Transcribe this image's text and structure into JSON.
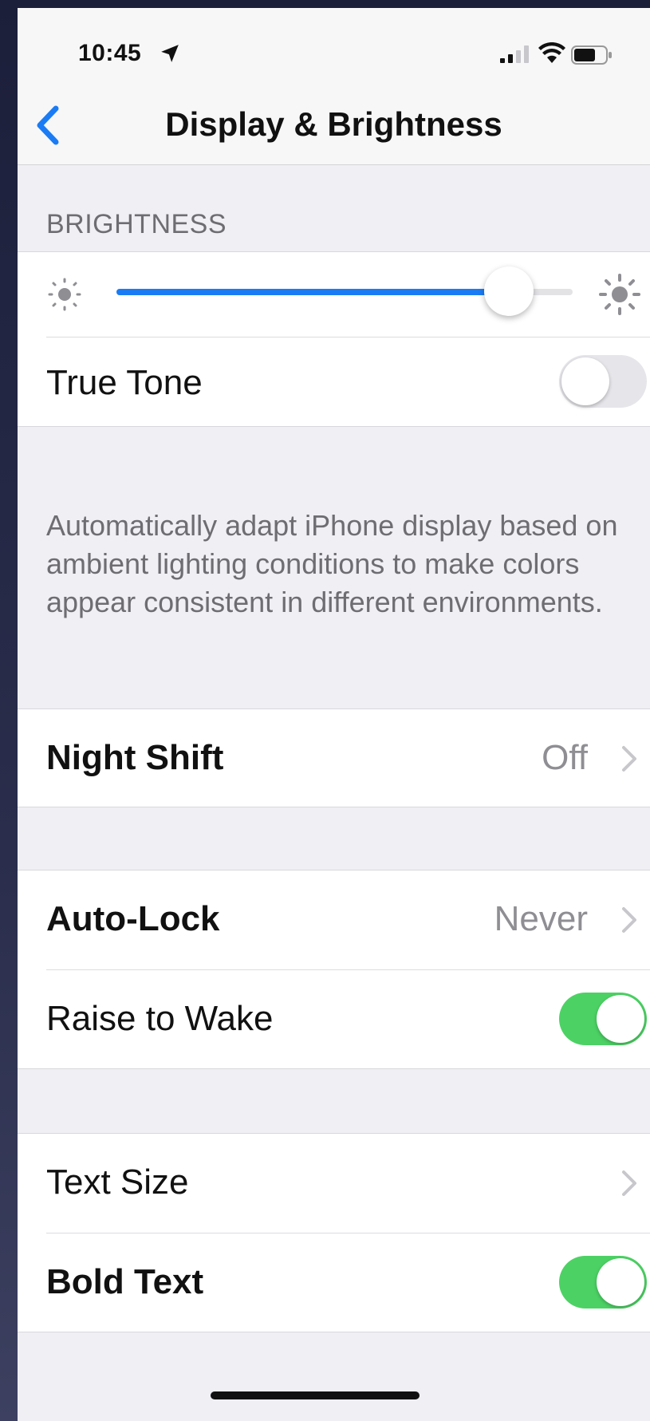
{
  "status_bar": {
    "time": "10:45"
  },
  "nav": {
    "title": "Display & Brightness",
    "back_icon": "chevron-left-icon"
  },
  "brightness": {
    "header": "BRIGHTNESS",
    "level": 0.86,
    "true_tone_label": "True Tone",
    "true_tone_on": false,
    "true_tone_footer": "Automatically adapt iPhone display based on ambient lighting conditions to make colors appear consistent in different environments."
  },
  "night_shift": {
    "label": "Night Shift",
    "value": "Off"
  },
  "lock": {
    "auto_lock_label": "Auto-Lock",
    "auto_lock_value": "Never",
    "raise_to_wake_label": "Raise to Wake",
    "raise_to_wake_on": true
  },
  "text": {
    "text_size_label": "Text Size",
    "bold_text_label": "Bold Text",
    "bold_text_on": true
  },
  "colors": {
    "accent_blue": "#1a7cf5",
    "toggle_on": "#4cd264"
  }
}
